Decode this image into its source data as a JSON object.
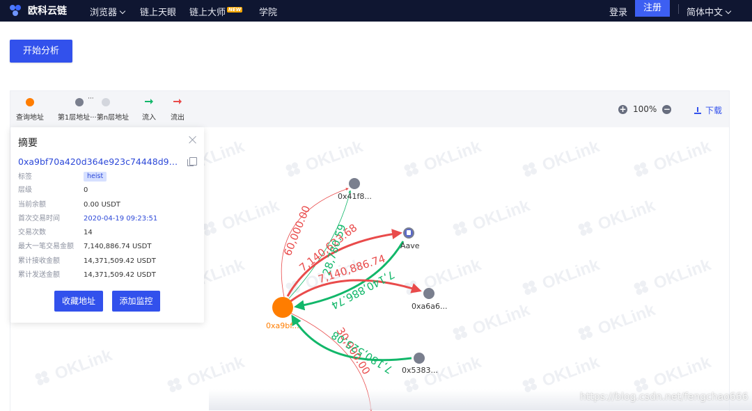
{
  "nav": {
    "brand": "欧科云链",
    "items": [
      {
        "label": "浏览器",
        "dropdown": true
      },
      {
        "label": "链上天眼"
      },
      {
        "label": "链上大师",
        "badge": "NEW"
      },
      {
        "label": "学院"
      }
    ],
    "login": "登录",
    "register": "注册",
    "language": "简体中文"
  },
  "analyze_button": "开始分析",
  "legend": {
    "query": "查询地址",
    "layers": "第1层地址···第n层地址",
    "ellipsis": "···",
    "inflow": "流入",
    "outflow": "流出"
  },
  "zoom": {
    "level": "100%"
  },
  "download": "下载",
  "summary": {
    "title": "摘要",
    "address": "0xa9bf70a420d364e923c74448d9d817...",
    "rows": [
      {
        "k": "标签",
        "v": "heist"
      },
      {
        "k": "层级",
        "v": "0"
      },
      {
        "k": "当前余额",
        "v": "0.00 USDT"
      },
      {
        "k": "首次交易时间",
        "v": "2020-04-19 09:23:51"
      },
      {
        "k": "交易次数",
        "v": "14"
      },
      {
        "k": "最大一笔交易金额",
        "v": "7,140,886.74 USDT"
      },
      {
        "k": "累计接收金额",
        "v": "14,371,509.42 USDT"
      },
      {
        "k": "累计发送金额",
        "v": "14,371,509.42 USDT"
      }
    ],
    "btn_favorite": "收藏地址",
    "btn_monitor": "添加监控"
  },
  "graph": {
    "watermark": "OKLink",
    "nodes": {
      "center": "0xa9bf...",
      "n1": "0x41f8...",
      "aave": "Aave",
      "n3": "0xa6a6...",
      "n4": "0x5383..."
    },
    "edges": {
      "e1": "60,000.00",
      "e2": "7,140,623.68",
      "e3": "28,780.59",
      "e4": "7,140,886.74",
      "e5": "7,140,886.74",
      "e6": "30,000.00",
      "e7": "7,180,525.08"
    },
    "colors": {
      "outflow": "#e94b4b",
      "inflow": "#12b76a",
      "query": "#ff7d00",
      "layer": "#7a7f8e"
    }
  },
  "url_watermark": "https://blog.csdn.net/fengchao666"
}
